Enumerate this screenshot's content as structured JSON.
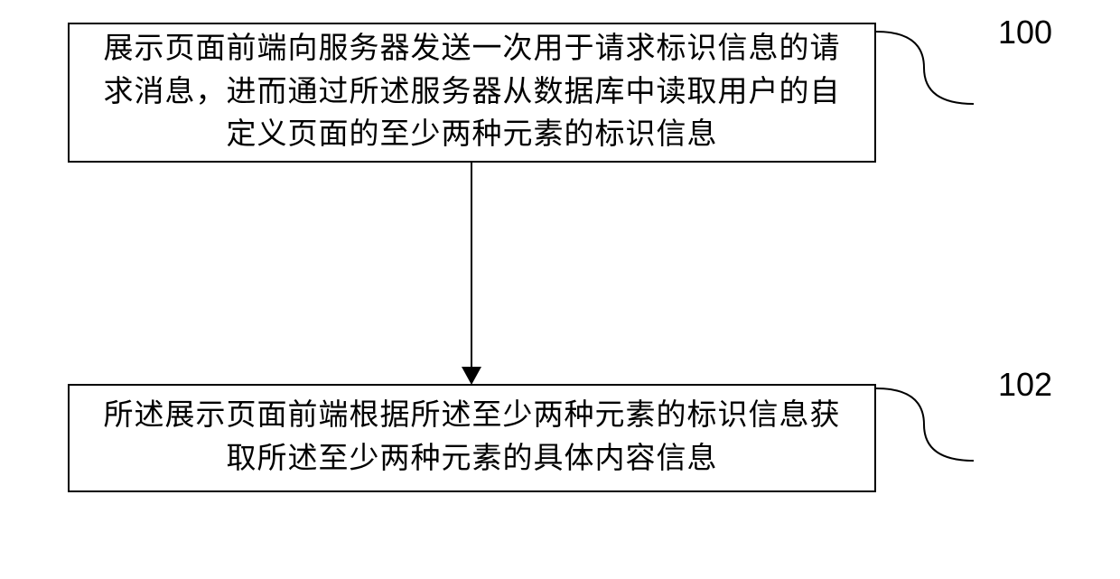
{
  "flowchart": {
    "boxes": [
      {
        "id": "step-100",
        "text": "展示页面前端向服务器发送一次用于请求标识信息的请求消息，进而通过所述服务器从数据库中读取用户的自定义页面的至少两种元素的标识信息",
        "label": "100"
      },
      {
        "id": "step-102",
        "text": "所述展示页面前端根据所述至少两种元素的标识信息获取所述至少两种元素的具体内容信息",
        "label": "102"
      }
    ],
    "arrow": {
      "from": "step-100",
      "to": "step-102"
    }
  }
}
